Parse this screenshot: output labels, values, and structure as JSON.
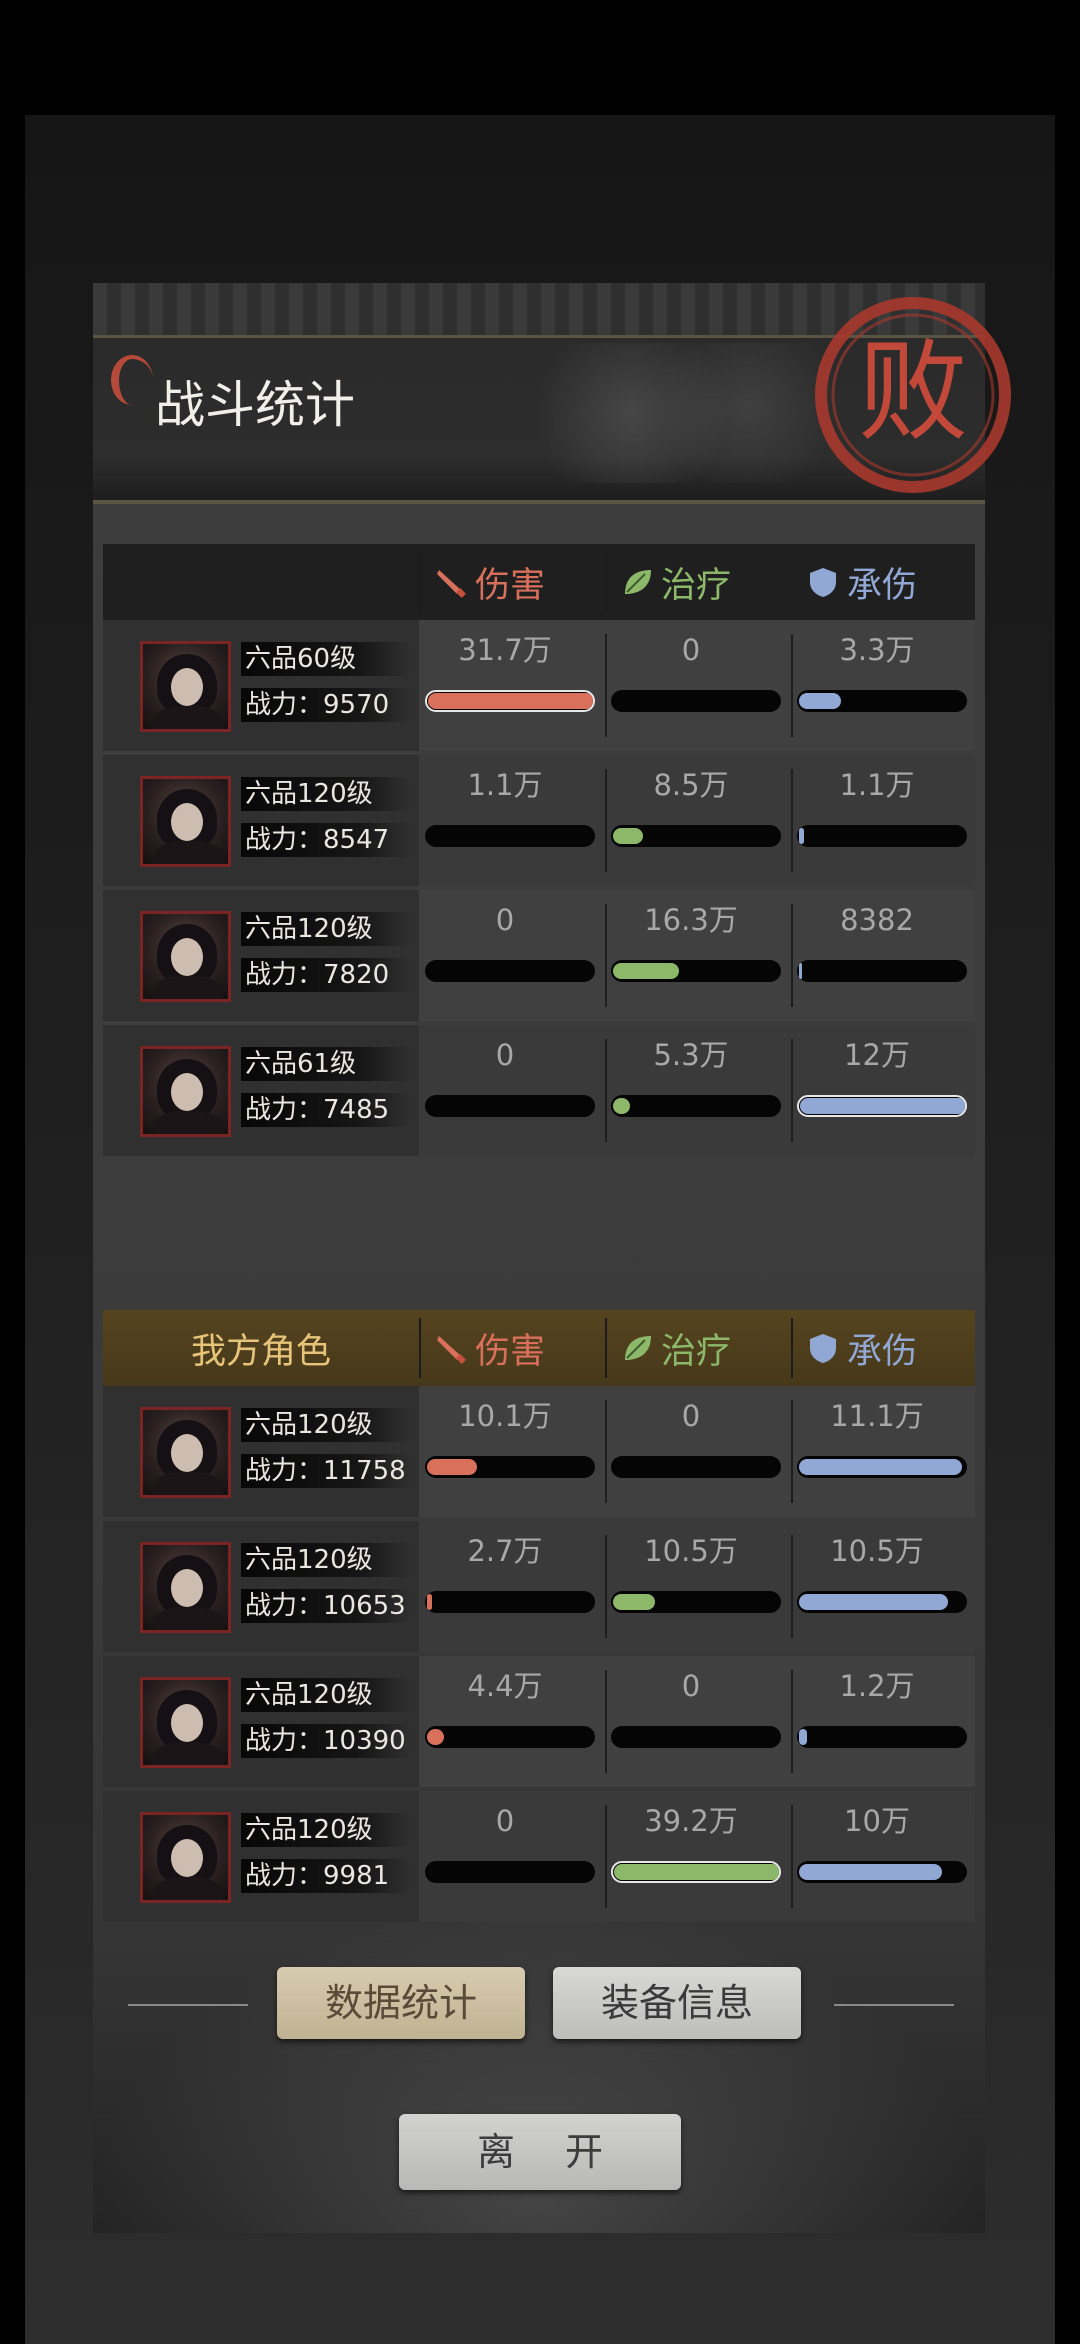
{
  "title": "战斗统计",
  "result_seal": "败",
  "colors": {
    "damage": "#d9705c",
    "heal": "#8db86a",
    "tank": "#91a7d4",
    "header_gold": "#e8c47a"
  },
  "columns": {
    "damage": "伤害",
    "heal": "治疗",
    "tank": "承伤"
  },
  "enemy_team": {
    "label": "",
    "rows": [
      {
        "level": "六品60级",
        "power_label": "战力：",
        "power": "9570",
        "damage": "31.7万",
        "damage_pct": 1.0,
        "heal": "0",
        "heal_pct": 0.0,
        "tank": "3.3万",
        "tank_pct": 0.25
      },
      {
        "level": "六品120级",
        "power_label": "战力：",
        "power": "8547",
        "damage": "1.1万",
        "damage_pct": 0.0,
        "heal": "8.5万",
        "heal_pct": 0.18,
        "tank": "1.1万",
        "tank_pct": 0.03
      },
      {
        "level": "六品120级",
        "power_label": "战力：",
        "power": "7820",
        "damage": "0",
        "damage_pct": 0.0,
        "heal": "16.3万",
        "heal_pct": 0.4,
        "tank": "8382",
        "tank_pct": 0.02
      },
      {
        "level": "六品61级",
        "power_label": "战力：",
        "power": "7485",
        "damage": "0",
        "damage_pct": 0.0,
        "heal": "5.3万",
        "heal_pct": 0.1,
        "tank": "12万",
        "tank_pct": 1.0
      }
    ]
  },
  "my_team": {
    "label": "我方角色",
    "rows": [
      {
        "level": "六品120级",
        "power_label": "战力：",
        "power": "11758",
        "damage": "10.1万",
        "damage_pct": 0.3,
        "heal": "0",
        "heal_pct": 0.0,
        "tank": "11.1万",
        "tank_pct": 0.98
      },
      {
        "level": "六品120级",
        "power_label": "战力：",
        "power": "10653",
        "damage": "2.7万",
        "damage_pct": 0.03,
        "heal": "10.5万",
        "heal_pct": 0.25,
        "tank": "10.5万",
        "tank_pct": 0.9
      },
      {
        "level": "六品120级",
        "power_label": "战力：",
        "power": "10390",
        "damage": "4.4万",
        "damage_pct": 0.1,
        "heal": "0",
        "heal_pct": 0.0,
        "tank": "1.2万",
        "tank_pct": 0.05
      },
      {
        "level": "六品120级",
        "power_label": "战力：",
        "power": "9981",
        "damage": "0",
        "damage_pct": 0.0,
        "heal": "39.2万",
        "heal_pct": 1.0,
        "tank": "10万",
        "tank_pct": 0.86
      }
    ]
  },
  "buttons": {
    "data_stats": "数据统计",
    "equipment_info": "装备信息",
    "leave": "离开"
  }
}
